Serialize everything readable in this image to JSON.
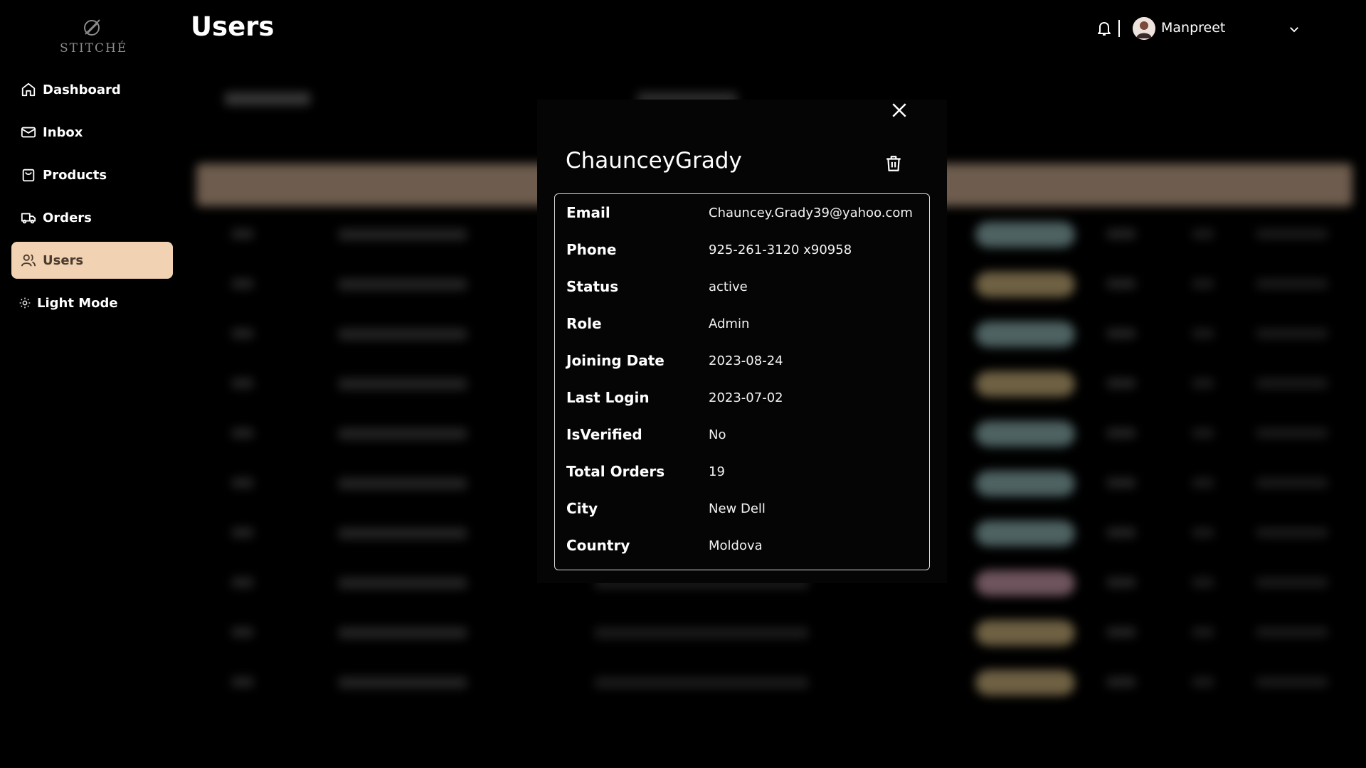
{
  "brand": {
    "name": "STITCHÉ"
  },
  "sidebar": {
    "items": [
      {
        "label": "Dashboard",
        "icon": "home-icon"
      },
      {
        "label": "Inbox",
        "icon": "mail-icon"
      },
      {
        "label": "Products",
        "icon": "bag-icon"
      },
      {
        "label": "Orders",
        "icon": "truck-icon"
      },
      {
        "label": "Users",
        "icon": "users-icon",
        "active": true
      },
      {
        "label": "Light Mode",
        "icon": "sun-icon"
      }
    ],
    "active_color": "#f1d2b2"
  },
  "header": {
    "title": "Users",
    "user_name": "Manpreet"
  },
  "modal": {
    "title": "ChaunceyGrady",
    "fields": [
      {
        "label": "Email",
        "value": "Chauncey.Grady39@yahoo.com"
      },
      {
        "label": "Phone",
        "value": "925-261-3120 x90958"
      },
      {
        "label": "Status",
        "value": "active"
      },
      {
        "label": "Role",
        "value": "Admin"
      },
      {
        "label": "Joining Date",
        "value": "2023-08-24"
      },
      {
        "label": "Last Login",
        "value": "2023-07-02"
      },
      {
        "label": "IsVerified",
        "value": "No"
      },
      {
        "label": "Total Orders",
        "value": "19"
      },
      {
        "label": "City",
        "value": "New Dell"
      },
      {
        "label": "Country",
        "value": "Moldova"
      }
    ]
  }
}
